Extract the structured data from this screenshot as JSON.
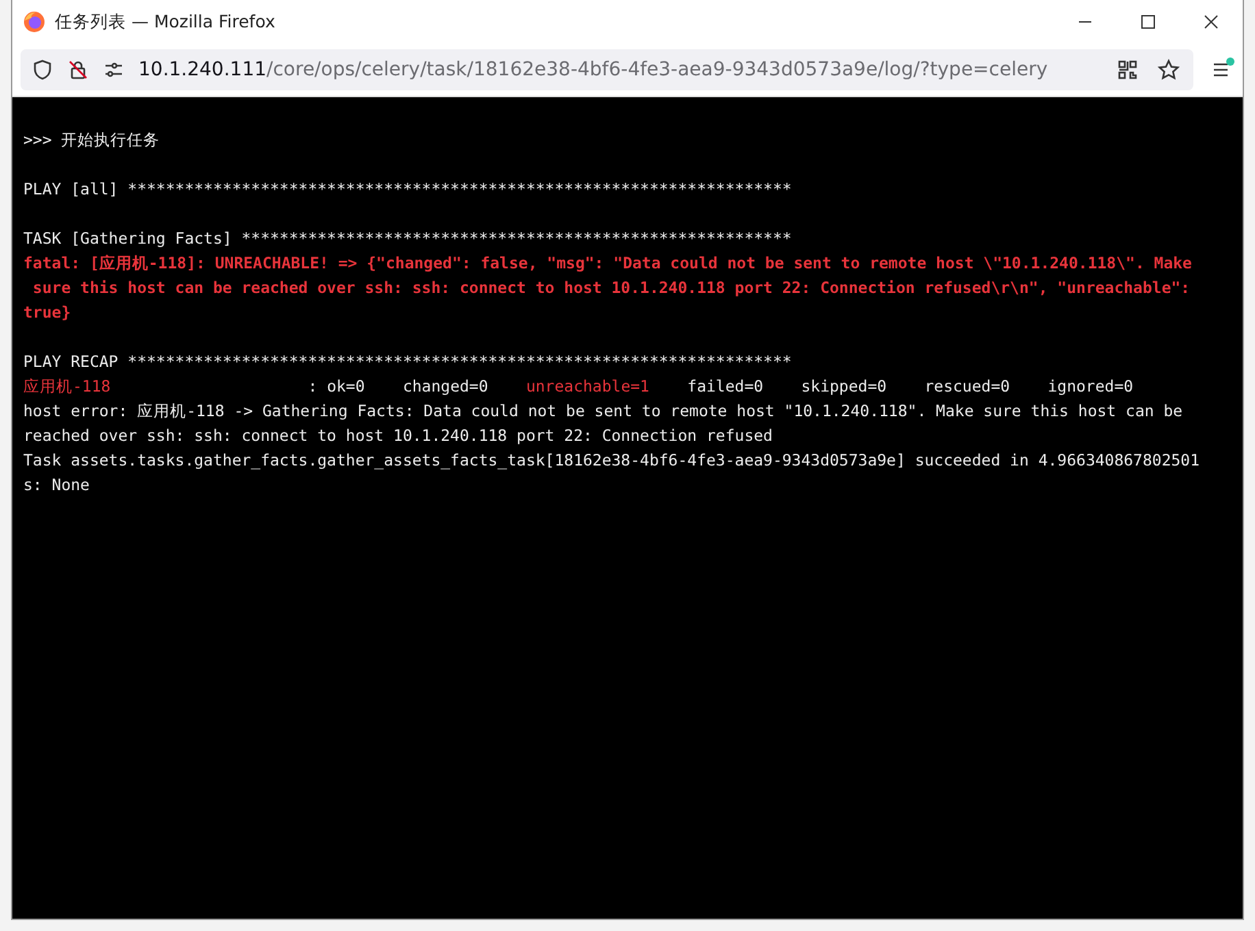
{
  "window": {
    "title": "任务列表 — Mozilla Firefox"
  },
  "address_bar": {
    "host": "10.1.240.111",
    "path": "/core/ops/celery/task/18162e38-4bf6-4fe3-aea9-9343d0573a9e/log/?type=celery"
  },
  "log": [
    {
      "kind": "text",
      "text": ">>> 开始执行任务"
    },
    {
      "kind": "blank"
    },
    {
      "kind": "text",
      "text": "PLAY [all] **********************************************************************"
    },
    {
      "kind": "blank"
    },
    {
      "kind": "text",
      "text": "TASK [Gathering Facts] **********************************************************"
    },
    {
      "kind": "error",
      "text": "fatal: [应用机-118]: UNREACHABLE! => {\"changed\": false, \"msg\": \"Data could not be sent to remote host \\\"10.1.240.118\\\". Make"
    },
    {
      "kind": "error",
      "text": " sure this host can be reached over ssh: ssh: connect to host 10.1.240.118 port 22: Connection refused\\r\\n\", \"unreachable\":"
    },
    {
      "kind": "error",
      "text": "true}"
    },
    {
      "kind": "blank"
    },
    {
      "kind": "text",
      "text": "PLAY RECAP **********************************************************************"
    },
    {
      "kind": "recap",
      "host": "应用机-118",
      "separator": ": ",
      "stats": [
        {
          "text": "ok=0",
          "highlighted": false
        },
        {
          "text": "changed=0",
          "highlighted": false
        },
        {
          "text": "unreachable=1",
          "highlighted": true
        },
        {
          "text": "failed=0",
          "highlighted": false
        },
        {
          "text": "skipped=0",
          "highlighted": false
        },
        {
          "text": "rescued=0",
          "highlighted": false
        },
        {
          "text": "ignored=0",
          "highlighted": false
        }
      ]
    },
    {
      "kind": "text",
      "text": "host error: 应用机-118 -> Gathering Facts: Data could not be sent to remote host \"10.1.240.118\". Make sure this host can be"
    },
    {
      "kind": "text",
      "text": "reached over ssh: ssh: connect to host 10.1.240.118 port 22: Connection refused"
    },
    {
      "kind": "text",
      "text": "Task assets.tasks.gather_facts.gather_assets_facts_task[18162e38-4bf6-4fe3-aea9-9343d0573a9e] succeeded in 4.966340867802501"
    },
    {
      "kind": "text",
      "text": "s: None"
    }
  ]
}
